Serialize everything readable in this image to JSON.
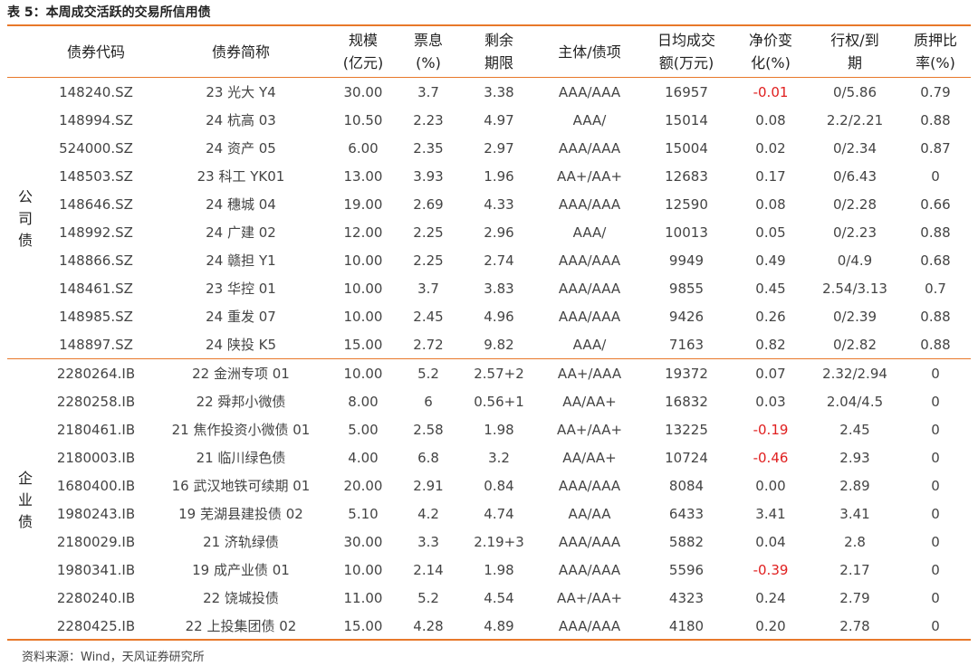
{
  "title": "表 5：本周成交活跃的交易所信用债",
  "headers": [
    "债券代码",
    "债券简称",
    "规模\n(亿元)",
    "票息\n(%)",
    "剩余\n期限",
    "主体/债项",
    "日均成交\n额(万元)",
    "净价变\n化(%)",
    "行权/到\n期",
    "质押比\n率(%)"
  ],
  "groups": [
    {
      "label": "公\n司\n债",
      "rows": [
        [
          "148240.SZ",
          "23 光大 Y4",
          "30.00",
          "3.7",
          "3.38",
          "AAA/AAA",
          "16957",
          "-0.01",
          "0/5.86",
          "0.79"
        ],
        [
          "148994.SZ",
          "24 杭高 03",
          "10.50",
          "2.23",
          "4.97",
          "AAA/",
          "15014",
          "0.08",
          "2.2/2.21",
          "0.88"
        ],
        [
          "524000.SZ",
          "24 资产 05",
          "6.00",
          "2.35",
          "2.97",
          "AAA/AAA",
          "15004",
          "0.02",
          "0/2.34",
          "0.87"
        ],
        [
          "148503.SZ",
          "23 科工 YK01",
          "13.00",
          "3.93",
          "1.96",
          "AA+/AA+",
          "12683",
          "0.17",
          "0/6.43",
          "0"
        ],
        [
          "148646.SZ",
          "24 穗城 04",
          "19.00",
          "2.69",
          "4.33",
          "AAA/AAA",
          "12590",
          "0.08",
          "0/2.28",
          "0.66"
        ],
        [
          "148992.SZ",
          "24 广建 02",
          "12.00",
          "2.25",
          "2.96",
          "AAA/",
          "10013",
          "0.05",
          "0/2.23",
          "0.88"
        ],
        [
          "148866.SZ",
          "24 赣担 Y1",
          "10.00",
          "2.25",
          "2.74",
          "AAA/AAA",
          "9949",
          "0.49",
          "0/4.9",
          "0.68"
        ],
        [
          "148461.SZ",
          "23 华控 01",
          "10.00",
          "3.7",
          "3.83",
          "AAA/AAA",
          "9855",
          "0.45",
          "2.54/3.13",
          "0.7"
        ],
        [
          "148985.SZ",
          "24 重发 07",
          "10.00",
          "2.45",
          "4.96",
          "AAA/AAA",
          "9426",
          "0.26",
          "0/2.39",
          "0.88"
        ],
        [
          "148897.SZ",
          "24 陕投 K5",
          "15.00",
          "2.72",
          "9.82",
          "AAA/",
          "7163",
          "0.82",
          "0/2.82",
          "0.88"
        ]
      ]
    },
    {
      "label": "企\n业\n债",
      "rows": [
        [
          "2280264.IB",
          "22 金洲专项 01",
          "10.00",
          "5.2",
          "2.57+2",
          "AA+/AAA",
          "19372",
          "0.07",
          "2.32/2.94",
          "0"
        ],
        [
          "2280258.IB",
          "22 舜邦小微债",
          "8.00",
          "6",
          "0.56+1",
          "AA/AA+",
          "16832",
          "0.03",
          "2.04/4.5",
          "0"
        ],
        [
          "2180461.IB",
          "21 焦作投资小微债 01",
          "5.00",
          "2.58",
          "1.98",
          "AA+/AA+",
          "13225",
          "-0.19",
          "2.45",
          "0"
        ],
        [
          "2180003.IB",
          "21 临川绿色债",
          "4.00",
          "6.8",
          "3.2",
          "AA/AA+",
          "10724",
          "-0.46",
          "2.93",
          "0"
        ],
        [
          "1680400.IB",
          "16 武汉地铁可续期 01",
          "20.00",
          "2.91",
          "0.84",
          "AAA/AAA",
          "8084",
          "0.00",
          "2.89",
          "0"
        ],
        [
          "1980243.IB",
          "19 芜湖县建投债 02",
          "5.10",
          "4.2",
          "4.74",
          "AA/AA",
          "6433",
          "3.41",
          "3.41",
          "0"
        ],
        [
          "2180029.IB",
          "21 济轨绿债",
          "30.00",
          "3.3",
          "2.19+3",
          "AAA/AAA",
          "5882",
          "0.04",
          "2.8",
          "0"
        ],
        [
          "1980341.IB",
          "19 成产业债 01",
          "10.00",
          "2.14",
          "1.98",
          "AAA/AAA",
          "5596",
          "-0.39",
          "2.17",
          "0"
        ],
        [
          "2280240.IB",
          "22 饶城投债",
          "11.00",
          "5.2",
          "4.54",
          "AA+/AA+",
          "4323",
          "0.24",
          "2.79",
          "0"
        ],
        [
          "2280425.IB",
          "22 上投集团债 02",
          "15.00",
          "4.28",
          "4.89",
          "AAA/AAA",
          "4180",
          "0.20",
          "2.78",
          "0"
        ]
      ]
    }
  ],
  "colors": {
    "accent_rule": "#e8782a",
    "negative": "#e02020"
  },
  "footer": "资料来源：Wind，天风证券研究所"
}
